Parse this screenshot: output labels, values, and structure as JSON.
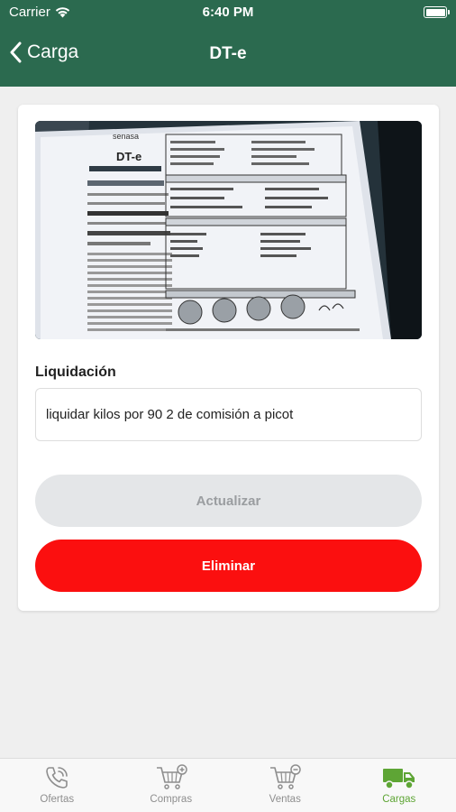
{
  "status": {
    "carrier": "Carrier",
    "time": "6:40 PM"
  },
  "nav": {
    "back_label": "Carga",
    "title": "DT-e"
  },
  "document": {
    "logo_text": "senasa",
    "doc_title": "DT-e"
  },
  "form": {
    "liquidacion_label": "Liquidación",
    "liquidacion_value": "liquidar kilos por 90 2 de comisión a picot"
  },
  "buttons": {
    "update_label": "Actualizar",
    "delete_label": "Eliminar"
  },
  "tabs": [
    {
      "label": "Ofertas",
      "icon": "phone-icon",
      "active": false
    },
    {
      "label": "Compras",
      "icon": "cart-plus-icon",
      "active": false
    },
    {
      "label": "Ventas",
      "icon": "cart-minus-icon",
      "active": false
    },
    {
      "label": "Cargas",
      "icon": "truck-icon",
      "active": true
    }
  ],
  "colors": {
    "header": "#2b6a4f",
    "delete": "#fb0f0f",
    "update_bg": "#e4e6e8",
    "tab_active": "#5ea535",
    "tab_inactive": "#8e8e8e"
  }
}
